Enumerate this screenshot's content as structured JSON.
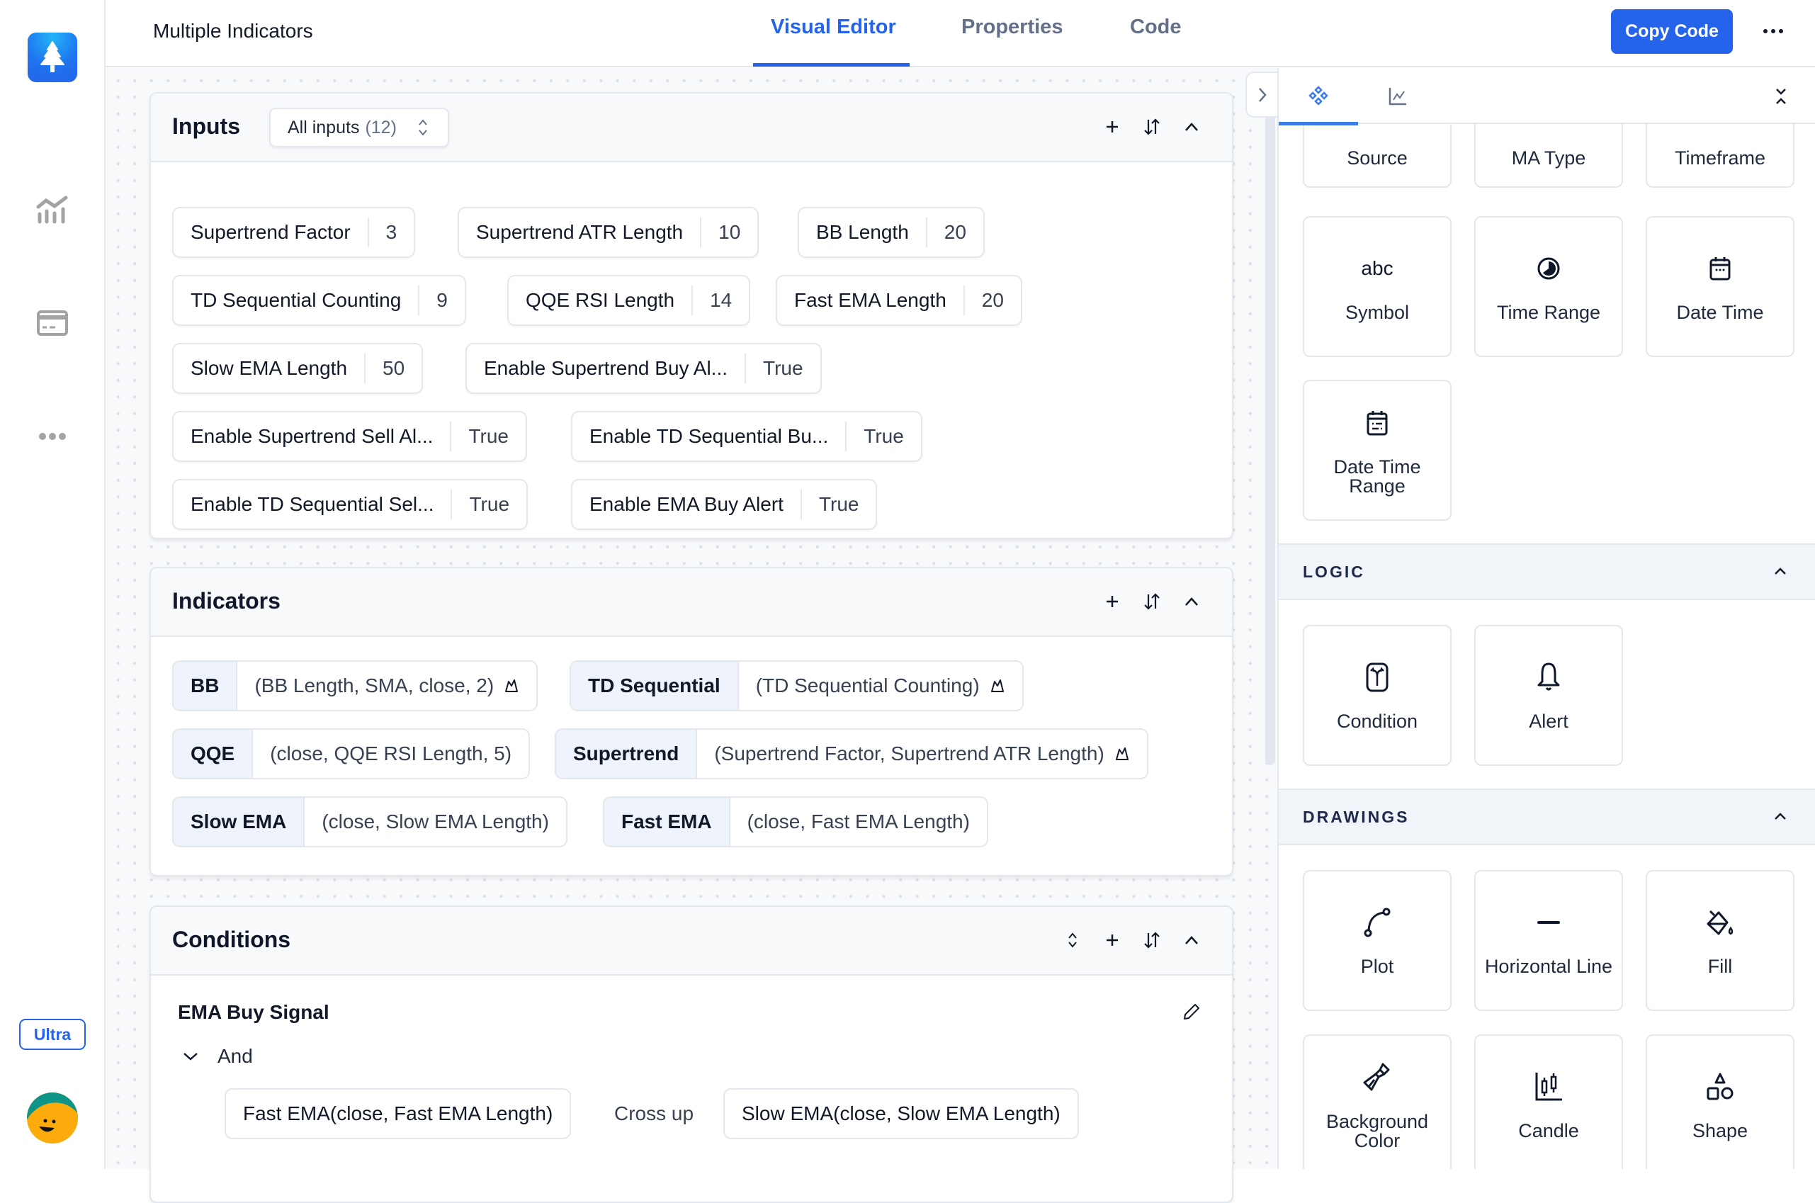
{
  "app": {
    "badge": "Ultra",
    "rail_icons": [
      "chart-icon",
      "card-icon",
      "more-icon"
    ]
  },
  "header": {
    "title": "Multiple Indicators",
    "tabs": [
      {
        "label": "Visual Editor",
        "active": true
      },
      {
        "label": "Properties",
        "active": false
      },
      {
        "label": "Code",
        "active": false
      }
    ],
    "copy_label": "Copy Code",
    "more_label": "⋯"
  },
  "inputs": {
    "title": "Inputs",
    "filter_label": "All inputs",
    "filter_count": "(12)",
    "items": [
      {
        "label": "Supertrend Factor",
        "value": "3"
      },
      {
        "label": "Supertrend ATR Length",
        "value": "10"
      },
      {
        "label": "BB Length",
        "value": "20"
      },
      {
        "label": "TD Sequential Counting",
        "value": "9"
      },
      {
        "label": "QQE RSI Length",
        "value": "14"
      },
      {
        "label": "Fast EMA Length",
        "value": "20"
      },
      {
        "label": "Slow EMA Length",
        "value": "50"
      },
      {
        "label": "Enable Supertrend Buy Al...",
        "value": "True"
      },
      {
        "label": "Enable Supertrend Sell Al...",
        "value": "True"
      },
      {
        "label": "Enable TD Sequential Bu...",
        "value": "True"
      },
      {
        "label": "Enable TD Sequential Sel...",
        "value": "True"
      },
      {
        "label": "Enable EMA Buy Alert",
        "value": "True"
      }
    ]
  },
  "indicators": {
    "title": "Indicators",
    "items": [
      {
        "name": "BB",
        "args": "(BB Length, SMA, close, 2)",
        "has_plot": true
      },
      {
        "name": "TD Sequential",
        "args": "(TD Sequential Counting)",
        "has_plot": true
      },
      {
        "name": "QQE",
        "args": "(close, QQE RSI Length, 5)",
        "has_plot": false
      },
      {
        "name": "Supertrend",
        "args": "(Supertrend Factor, Supertrend ATR Length)",
        "has_plot": true
      },
      {
        "name": "Slow EMA",
        "args": "(close, Slow EMA Length)",
        "has_plot": false
      },
      {
        "name": "Fast EMA",
        "args": "(close, Fast EMA Length)",
        "has_plot": false
      }
    ]
  },
  "conditions": {
    "title": "Conditions",
    "items": [
      {
        "name": "EMA Buy Signal",
        "group": "And",
        "left": "Fast EMA(close, Fast EMA Length)",
        "operator": "Cross up",
        "right": "Slow EMA(close, Slow EMA Length)"
      }
    ]
  },
  "panel": {
    "tabs": [
      "blocks-icon",
      "chart-line-icon"
    ],
    "inputs_tiles": [
      {
        "label": "Source",
        "icon": ""
      },
      {
        "label": "MA Type",
        "icon": ""
      },
      {
        "label": "Timeframe",
        "icon": ""
      },
      {
        "label": "Symbol",
        "icon": "abc"
      },
      {
        "label": "Time Range",
        "icon": "clock-icon"
      },
      {
        "label": "Date Time",
        "icon": "calendar-icon"
      },
      {
        "label": "Date Time Range",
        "icon": "calendar-range-icon"
      }
    ],
    "logic": {
      "title": "LOGIC",
      "tiles": [
        {
          "label": "Condition",
          "icon": "split-icon"
        },
        {
          "label": "Alert",
          "icon": "bell-icon"
        }
      ]
    },
    "drawings": {
      "title": "DRAWINGS",
      "tiles": [
        {
          "label": "Plot",
          "icon": "curve-icon"
        },
        {
          "label": "Horizontal Line",
          "icon": "minus-icon"
        },
        {
          "label": "Fill",
          "icon": "paint-bucket-icon"
        },
        {
          "label": "Background Color",
          "icon": "brush-icon"
        },
        {
          "label": "Candle",
          "icon": "candle-icon"
        },
        {
          "label": "Shape",
          "icon": "shapes-icon"
        }
      ]
    }
  },
  "colors": {
    "accent": "#2563eb",
    "tab_inactive": "#64708a",
    "indicator_name_bg": "#eef3fc",
    "section_bg": "#f1f4f9"
  }
}
